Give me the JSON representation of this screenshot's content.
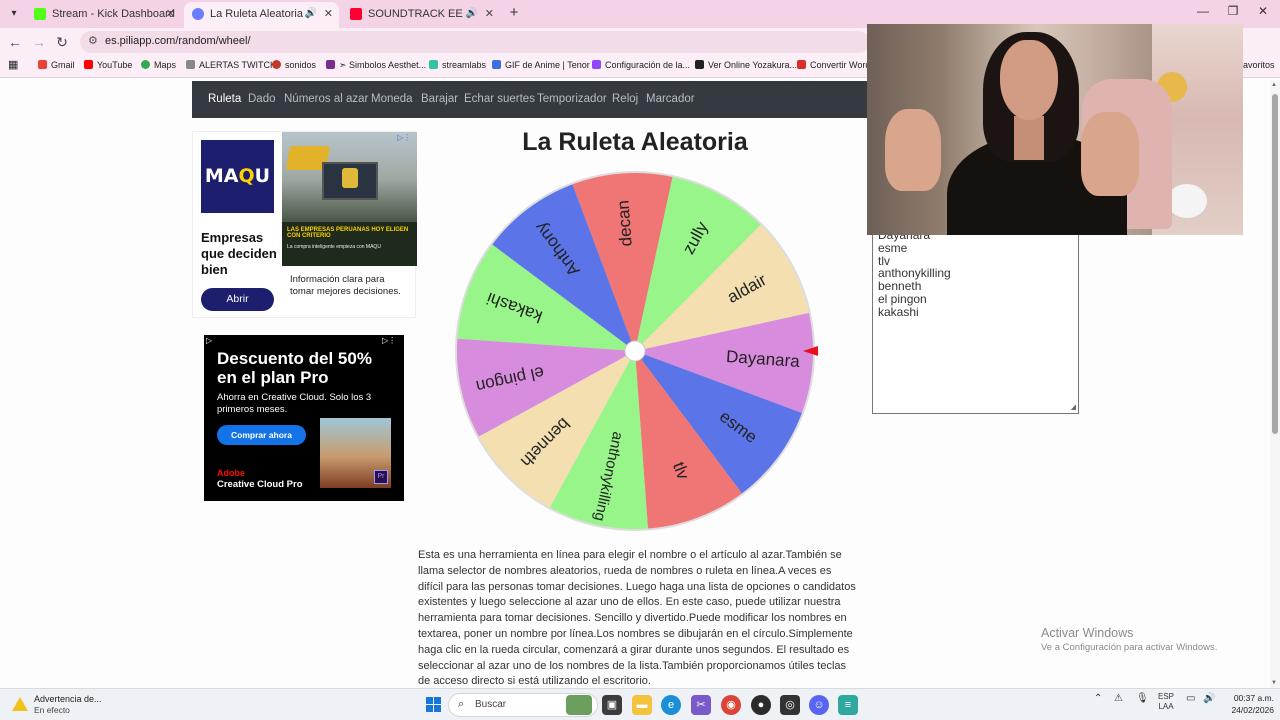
{
  "browser": {
    "tabs": [
      {
        "title": "Stream - Kick Dashboard",
        "favicon_color": "#53fc18",
        "active": false
      },
      {
        "title": "La Ruleta Aleatoria",
        "favicon_color": "#6a7cff",
        "active": true
      },
      {
        "title": "SOUNDTRACK EEG | TROM",
        "favicon_color": "#ff0033",
        "active": false
      }
    ],
    "new_tab_icon": "plus-icon",
    "url": "es.piliapp.com/random/wheel/",
    "bookmarks": [
      {
        "label": "Gmail",
        "color": "#ea4335"
      },
      {
        "label": "YouTube",
        "color": "#ff0000"
      },
      {
        "label": "Maps",
        "color": "#34a853"
      },
      {
        "label": "ALERTAS TWITCH",
        "color": "#888888"
      },
      {
        "label": "sonidos",
        "color": "#c0392b"
      },
      {
        "label": "➣ Simbolos Aesthet...",
        "color": "#7b2c8f"
      },
      {
        "label": "streamlabs",
        "color": "#31c3a2"
      },
      {
        "label": "GIF de Anime | Tenor",
        "color": "#3d6fe0"
      },
      {
        "label": "Configuración de la...",
        "color": "#9147ff"
      },
      {
        "label": "Ver Online Yozakura...",
        "color": "#222222"
      },
      {
        "label": "Convertir Word",
        "color": "#d93025"
      },
      {
        "label": "avoritos",
        "color": "#f4d3e6"
      }
    ]
  },
  "site_nav": {
    "items": [
      "Ruleta",
      "Dado",
      "Números al azar",
      "Moneda",
      "Barajar",
      "Echar suertes",
      "Temporizador",
      "Reloj",
      "Marcador"
    ],
    "active": "Ruleta"
  },
  "ad_maqu": {
    "logo_a": "MA",
    "logo_b": "Q",
    "logo_c": "U",
    "headline": "Empresas que deciden bien",
    "button": "Abrir",
    "description": "Información clara para tomar mejores decisiones.",
    "banner_line1": "LAS EMPRESAS PERUANAS HOY ELIGEN CON CRITERIO",
    "banner_line2": "La compra inteligente empieza con MAQU"
  },
  "ad_adobe": {
    "headline": "Descuento del 50% en el plan Pro",
    "subtitle": "Ahorra en Creative Cloud. Solo los 3 primeros meses.",
    "button": "Comprar ahora",
    "brand_line1": "Adobe",
    "brand_line2": "Creative Cloud Pro",
    "badge": "Pr"
  },
  "wheel": {
    "title": "La Ruleta Aleatoria",
    "segments": [
      {
        "label": "Dayanara",
        "color": "#d88cde"
      },
      {
        "label": "esme",
        "color": "#5b74e8"
      },
      {
        "label": "tlv",
        "color": "#f07575"
      },
      {
        "label": "anthonykilling",
        "color": "#98f58a"
      },
      {
        "label": "benneth",
        "color": "#f3dfb0"
      },
      {
        "label": "el pingon",
        "color": "#d88cde"
      },
      {
        "label": "kakashi",
        "color": "#98f58a"
      },
      {
        "label": "Anthony",
        "color": "#5b74e8"
      },
      {
        "label": "decan",
        "color": "#f07575"
      },
      {
        "label": "zully",
        "color": "#98f58a"
      },
      {
        "label": "aldair",
        "color": "#f3dfb0"
      }
    ],
    "pointer_color": "#e8101a"
  },
  "names_textarea": {
    "lines": [
      "Dayanara",
      "esme",
      "tlv",
      "anthonykilling",
      "benneth",
      "el pingon",
      "kakashi"
    ]
  },
  "description": "Esta es una herramienta en línea para elegir el nombre o el artículo al azar.También se llama selector de nombres aleatorios, rueda de nombres o ruleta en línea.A veces es difícil para las personas tomar decisiones. Luego haga una lista de opciones o candidatos existentes y luego seleccione al azar uno de ellos. En este caso, puede utilizar nuestra herramienta para tomar decisiones. Sencillo y divertido.Puede modificar los nombres en textarea, poner un nombre por línea.Los nombres se dibujarán en el círculo.Simplemente haga clic en la rueda circular, comenzará a girar durante unos segundos. El resultado es seleccionar al azar uno de los nombres de la lista.También proporcionamos útiles teclas de acceso directo si está utilizando el escritorio.",
  "windows_watermark": {
    "line1": "Activar Windows",
    "line2": "Ve a Configuración para activar Windows."
  },
  "taskbar": {
    "notice_title": "Advertencia de...",
    "notice_sub": "En efecto",
    "search_placeholder": "Buscar",
    "lang_line1": "ESP",
    "lang_line2": "LAA",
    "time": "00:37 a.m.",
    "date": "24/02/2026"
  }
}
